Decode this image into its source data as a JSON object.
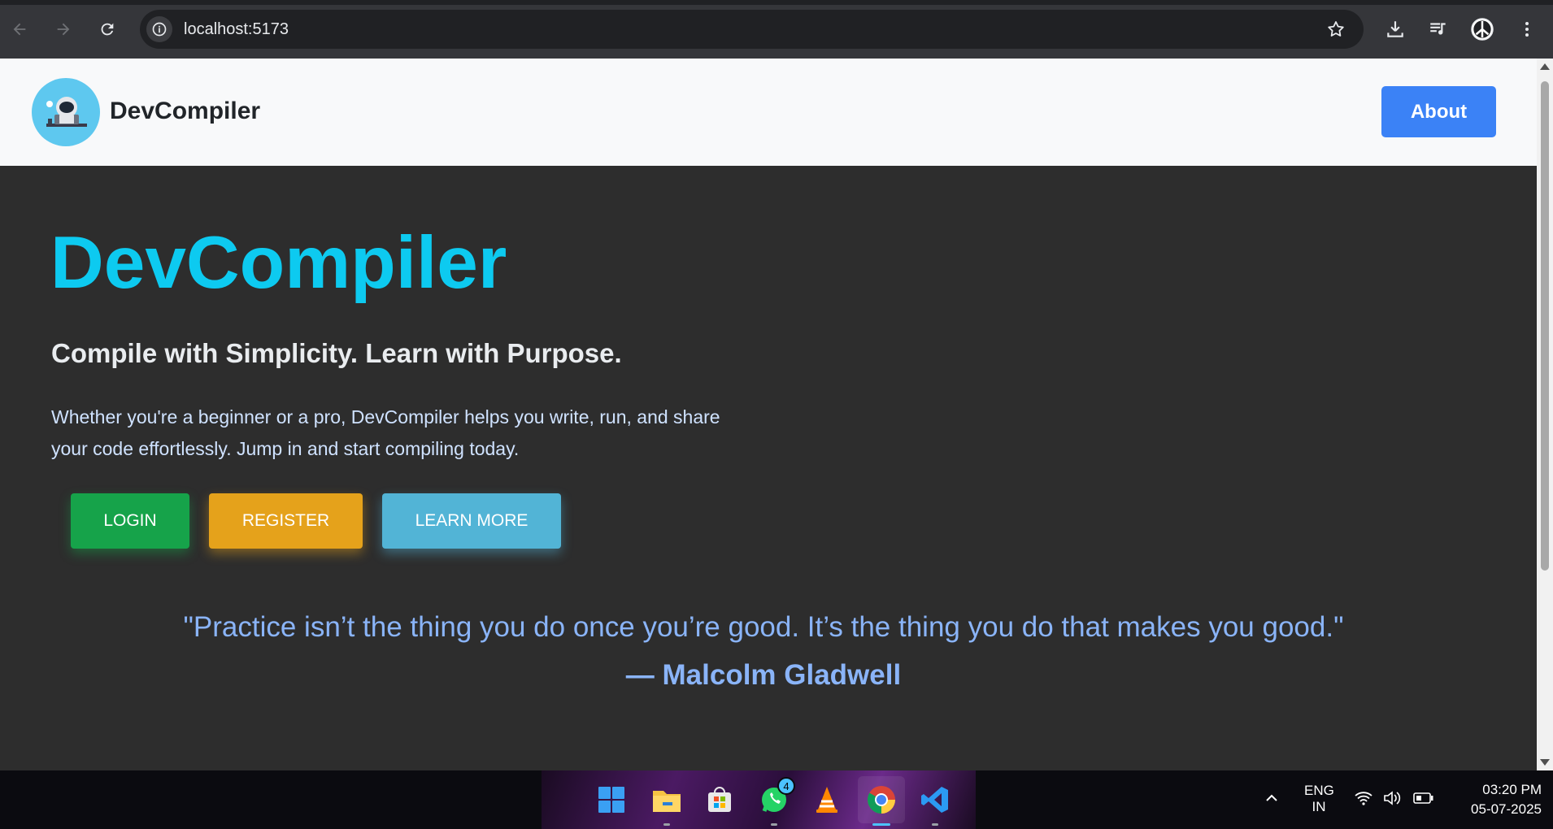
{
  "browser": {
    "url": "localhost:5173"
  },
  "site": {
    "brand": "DevCompiler",
    "about_label": "About"
  },
  "hero": {
    "title": "DevCompiler",
    "tagline": "Compile with Simplicity. Learn with Purpose.",
    "description_line1": "Whether you're a beginner or a pro, DevCompiler helps you write, run, and share",
    "description_line2": "your code effortlessly. Jump in and start compiling today.",
    "buttons": {
      "login": "LOGIN",
      "register": "REGISTER",
      "learn_more": "LEARN MORE"
    }
  },
  "quote": {
    "text": "\"Practice isn’t the thing you do once you’re good. It’s the thing you do that makes you good.\"",
    "author": "— Malcolm Gladwell"
  },
  "taskbar": {
    "whatsapp_badge": "4",
    "lang_line1": "ENG",
    "lang_line2": "IN",
    "time": "03:20 PM",
    "date": "05-07-2025"
  },
  "colors": {
    "accent_cyan": "#0dcaf0",
    "about_blue": "#3b82f6",
    "login_green": "#16a34a",
    "register_amber": "#e5a21b",
    "learn_blue": "#52b4d6",
    "quote_blue": "#8ab4f8"
  }
}
